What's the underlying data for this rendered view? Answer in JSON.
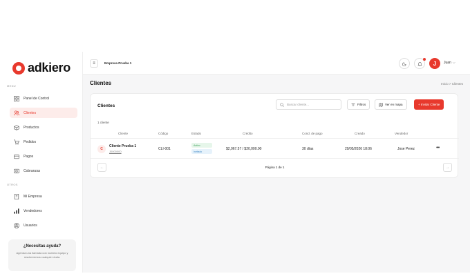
{
  "brand": {
    "logo_text": "adkiero",
    "accent": "#e8392d"
  },
  "sidebar": {
    "menu_label": "MENU",
    "others_label": "OTROS",
    "items": [
      {
        "label": "Panel de Control",
        "icon": "grid-icon"
      },
      {
        "label": "Clientes",
        "icon": "users-icon",
        "active": true
      },
      {
        "label": "Productos",
        "icon": "box-icon"
      },
      {
        "label": "Pedidos",
        "icon": "cart-icon"
      },
      {
        "label": "Pagos",
        "icon": "card-icon"
      },
      {
        "label": "Cobranzas",
        "icon": "money-icon"
      }
    ],
    "others": [
      {
        "label": "Mi Empresa",
        "icon": "building-icon"
      },
      {
        "label": "Vendedores",
        "icon": "chart-icon"
      },
      {
        "label": "Usuarios",
        "icon": "user-circle-icon"
      }
    ],
    "help": {
      "title": "¿Necesitas ayuda?",
      "text": "Agenda una llamada con nuestro equipo y resolveremos cualquier duda."
    }
  },
  "topbar": {
    "company": "Empresa Prueba 1",
    "avatar_initial": "J",
    "user_name": "Juan"
  },
  "page": {
    "title": "Clientes",
    "breadcrumb": "Inicio  >  Clientes"
  },
  "card": {
    "title": "Clientes",
    "search_placeholder": "Buscar cliente...",
    "filters_label": "Filtros",
    "map_label": "Ver en mapa",
    "invite_label": "+ Invitar Cliente",
    "count_text": "1 cliente",
    "columns": [
      "Cliente",
      "Código",
      "Estado",
      "Crédito",
      "Cond. de pago",
      "Creado",
      "Vendedor"
    ],
    "rows": [
      {
        "initial": "C",
        "name": "Cliente Prueba 1",
        "id": "J0000000",
        "code": "CLI-001",
        "status1": "Activo",
        "status2": "Invitado",
        "credit": "$2,067.57 / $20,000.00",
        "payment": "30 días",
        "created": "29/05/2026 18:06",
        "seller": "Jose Perez"
      }
    ],
    "pager_text": "Página 1 de 1"
  }
}
